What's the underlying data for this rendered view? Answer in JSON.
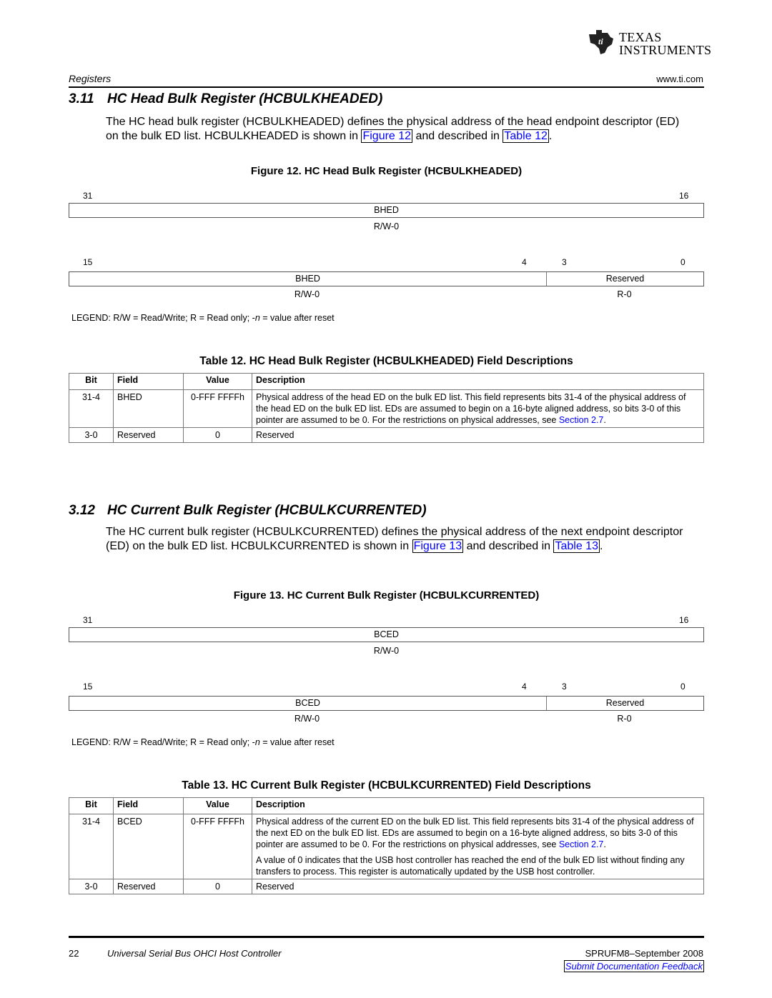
{
  "header": {
    "logo_line1": "Texas",
    "logo_line2": "Instruments",
    "section_label": "Registers",
    "url": "www.ti.com"
  },
  "section_311": {
    "number": "3.11",
    "title": "HC Head Bulk Register (HCBULKHEADED)",
    "para_pre": "The HC head bulk register (HCBULKHEADED) defines the physical address of the head endpoint descriptor (ED) on the bulk ED list. HCBULKHEADED is shown in ",
    "figure_link": "Figure 12",
    "para_mid": " and described in ",
    "table_link": "Table 12",
    "para_post": ".",
    "figure_caption": "Figure 12. HC Head Bulk Register (HCBULKHEADED)",
    "register": {
      "upper": {
        "bit_hi": "31",
        "bit_lo": "16",
        "field": "BHED",
        "access": "R/W-0"
      },
      "lower": {
        "bit_hi": "15",
        "bit_mid_hi": "4",
        "bit_mid_lo": "3",
        "bit_lo": "0",
        "field1": "BHED",
        "access1": "R/W-0",
        "field2": "Reserved",
        "access2": "R-0"
      },
      "legend_pre": "LEGEND: R/W = Read/Write; R = Read only; -",
      "legend_n": "n",
      "legend_post": " = value after reset"
    },
    "table_caption": "Table 12. HC Head Bulk Register (HCBULKHEADED) Field Descriptions",
    "table": {
      "headers": [
        "Bit",
        "Field",
        "Value",
        "Description"
      ],
      "rows": [
        {
          "bit": "31-4",
          "field": "BHED",
          "value": "0-FFF FFFFh",
          "desc_pre": "Physical address of the head ED on the bulk ED list. This field represents bits 31-4 of the physical address of the head ED on the bulk ED list. EDs are assumed to begin on a 16-byte aligned address, so bits 3-0 of this pointer are assumed to be 0. For the restrictions on physical addresses, see ",
          "desc_link": "Section 2.7",
          "desc_post": "."
        },
        {
          "bit": "3-0",
          "field": "Reserved",
          "value": "0",
          "desc": "Reserved"
        }
      ]
    }
  },
  "section_312": {
    "number": "3.12",
    "title": "HC Current Bulk Register (HCBULKCURRENTED)",
    "para_pre": "The HC current bulk register (HCBULKCURRENTED) defines the physical address of the next endpoint descriptor (ED) on the bulk ED list. HCBULKCURRENTED is shown in ",
    "figure_link": "Figure 13",
    "para_mid": " and described in ",
    "table_link": "Table 13",
    "para_post": ".",
    "figure_caption": "Figure 13. HC Current Bulk Register (HCBULKCURRENTED)",
    "register": {
      "upper": {
        "bit_hi": "31",
        "bit_lo": "16",
        "field": "BCED",
        "access": "R/W-0"
      },
      "lower": {
        "bit_hi": "15",
        "bit_mid_hi": "4",
        "bit_mid_lo": "3",
        "bit_lo": "0",
        "field1": "BCED",
        "access1": "R/W-0",
        "field2": "Reserved",
        "access2": "R-0"
      },
      "legend_pre": "LEGEND: R/W = Read/Write; R = Read only; -",
      "legend_n": "n",
      "legend_post": " = value after reset"
    },
    "table_caption": "Table 13. HC Current Bulk Register (HCBULKCURRENTED) Field Descriptions",
    "table": {
      "headers": [
        "Bit",
        "Field",
        "Value",
        "Description"
      ],
      "rows": [
        {
          "bit": "31-4",
          "field": "BCED",
          "value": "0-FFF FFFFh",
          "desc_pre": "Physical address of the current ED on the bulk ED list. This field represents bits 31-4 of the physical address of the next ED on the bulk ED list. EDs are assumed to begin on a 16-byte aligned address, so bits 3-0 of this pointer are assumed to be 0. For the restrictions on physical addresses, see ",
          "desc_link": "Section 2.7",
          "desc_post": ".",
          "desc2": "A value of 0 indicates that the USB host controller has reached the end of the bulk ED list without finding any transfers to process. This register is automatically updated by the USB host controller."
        },
        {
          "bit": "3-0",
          "field": "Reserved",
          "value": "0",
          "desc": "Reserved"
        }
      ]
    }
  },
  "footer": {
    "page_number": "22",
    "doc_title": "Universal Serial Bus OHCI Host Controller",
    "doc_id": "SPRUFM8–September 2008",
    "feedback_link": "Submit Documentation Feedback"
  }
}
